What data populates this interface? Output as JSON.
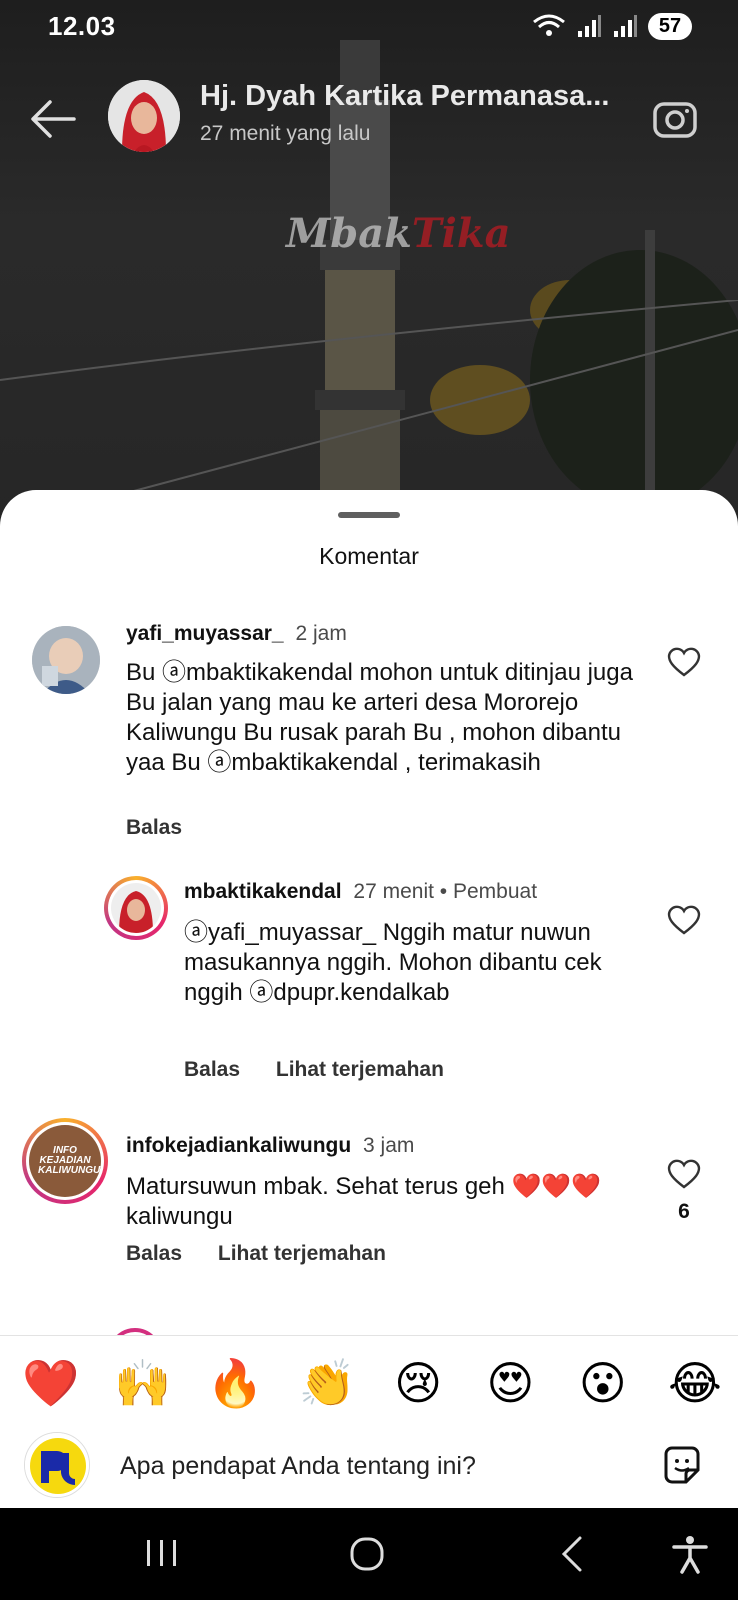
{
  "status_bar": {
    "time": "12.03",
    "battery": "57"
  },
  "story": {
    "author": "Hj. Dyah Kartika Permanasa...",
    "time_ago": "27 menit yang lalu",
    "watermark_a": "Mbak",
    "watermark_b": "Tika"
  },
  "sheet": {
    "title": "Komentar",
    "comments": [
      {
        "user": "yafi_muyassar_",
        "meta": "2 jam",
        "text": "Bu ⓐmbaktikakendal mohon untuk ditinjau juga Bu jalan yang mau ke arteri desa Mororejo Kaliwungu Bu rusak parah Bu , mohon dibantu yaa Bu ⓐmbaktikakendal , terimakasih",
        "reply": "Balas"
      },
      {
        "user": "mbaktikakendal",
        "meta": "27 menit • Pembuat",
        "text": "ⓐyafi_muyassar_ Nggih matur nuwun masukannya nggih. Mohon dibantu cek nggih ⓐdpupr.kendalkab",
        "reply": "Balas",
        "translate": "Lihat terjemahan"
      },
      {
        "user": "infokejadiankaliwungu",
        "meta": "3 jam",
        "text": "Matursuwun mbak. Sehat terus geh ❤️❤️❤️ kaliwungu",
        "reply": "Balas",
        "translate": "Lihat terjemahan",
        "likes": "6",
        "avatar_text": "INFO KEJADIAN KALIWUNGU"
      }
    ]
  },
  "compose": {
    "emojis": [
      "❤️",
      "🙌",
      "🔥",
      "👏",
      "😢",
      "😍",
      "😮",
      "😂"
    ],
    "placeholder": "Apa pendapat Anda tentang ini?"
  },
  "colors": {
    "accent_ring": "#e6266b",
    "sheet_bg": "#ffffff",
    "text": "#111111"
  }
}
